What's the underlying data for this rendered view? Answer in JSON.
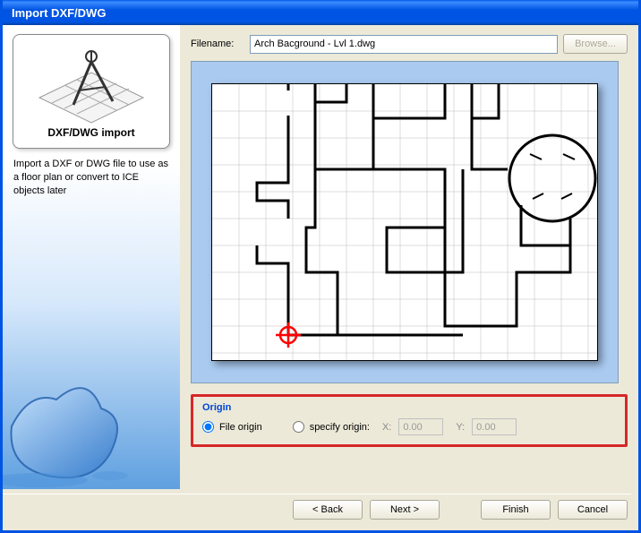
{
  "window": {
    "title": "Import DXF/DWG"
  },
  "sidebar": {
    "illust_label": "DXF/DWG import",
    "description": "Import a DXF or DWG file to use as a floor plan or convert to ICE objects later"
  },
  "file": {
    "label": "Filename:",
    "value": "Arch Bacground - Lvl 1.dwg",
    "browse_label": "Browse..."
  },
  "origin": {
    "legend": "Origin",
    "file_origin_label": "File origin",
    "specify_origin_label": "specify origin:",
    "x_label": "X:",
    "y_label": "Y:",
    "x_value": "0.00",
    "y_value": "0.00",
    "selected": "file_origin"
  },
  "buttons": {
    "back": "< Back",
    "next": "Next >",
    "finish": "Finish",
    "cancel": "Cancel"
  }
}
